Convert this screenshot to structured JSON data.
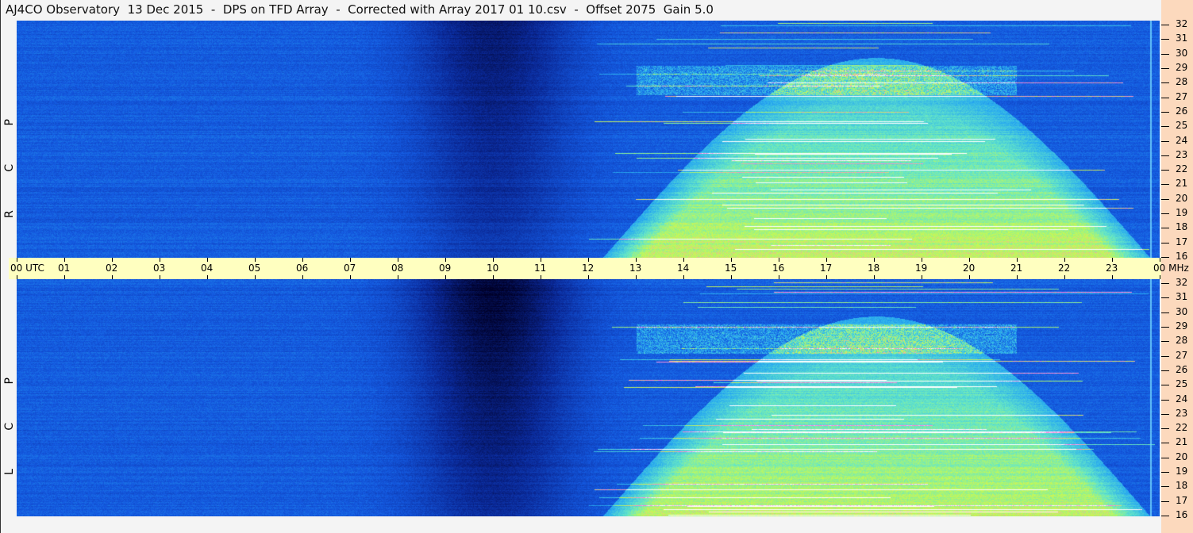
{
  "title": "AJ4CO Observatory  13 Dec 2015  -  DPS on TFD Array  -  Corrected with Array 2017 01 10.csv  -  Offset 2075  Gain 5.0",
  "chart_data": {
    "type": "heatmap",
    "title": "AJ4CO Observatory  13 Dec 2015  -  DPS on TFD Array  -  Corrected with Array 2017 01 10.csv  -  Offset 2075  Gain 5.0",
    "xlabel": "UTC",
    "ylabel": "MHz",
    "xlim": [
      0,
      24
    ],
    "ylim": [
      16,
      32
    ],
    "x_ticks": [
      "00 UTC",
      "01",
      "02",
      "03",
      "04",
      "05",
      "06",
      "07",
      "08",
      "09",
      "10",
      "11",
      "12",
      "13",
      "14",
      "15",
      "16",
      "17",
      "18",
      "19",
      "20",
      "21",
      "22",
      "23",
      "00 MHz"
    ],
    "y_ticks": [
      "32",
      "31",
      "30",
      "29",
      "28",
      "27",
      "26",
      "25",
      "24",
      "23",
      "22",
      "21",
      "20",
      "19",
      "18",
      "17",
      "16"
    ],
    "panels": [
      {
        "name": "R C P",
        "label": "R C P"
      },
      {
        "name": "L C P",
        "label": "L C P"
      }
    ],
    "features": {
      "night_dark_hours": [
        7.5,
        13
      ],
      "daytime_activity_hours": [
        12,
        24
      ],
      "strong_band_MHz": [
        27,
        29
      ]
    }
  }
}
